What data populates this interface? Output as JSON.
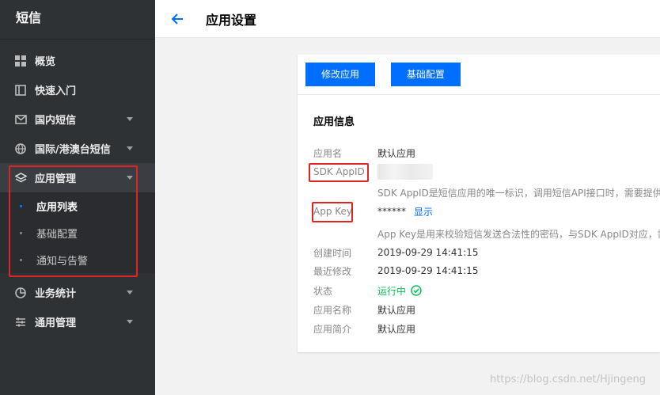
{
  "sidebar": {
    "brand": "短信",
    "items": [
      {
        "label": "概览"
      },
      {
        "label": "快速入门"
      },
      {
        "label": "国内短信"
      },
      {
        "label": "国际/港澳台短信"
      }
    ],
    "group": {
      "label": "应用管理",
      "sub": [
        {
          "label": "应用列表"
        },
        {
          "label": "基础配置"
        },
        {
          "label": "通知与告警"
        }
      ]
    },
    "bottom": [
      {
        "label": "业务统计"
      },
      {
        "label": "通用管理"
      }
    ]
  },
  "header": {
    "title": "应用设置"
  },
  "card": {
    "buttons": {
      "edit": "修改应用",
      "config": "基础配置"
    },
    "section_title": "应用信息",
    "rows": {
      "app_name": {
        "label": "应用名",
        "value": "默认应用"
      },
      "sdk_appid": {
        "label": "SDK AppID"
      },
      "sdk_hint": "SDK AppID是短信应用的唯一标识，调用短信API接口时，需要提供",
      "app_key": {
        "label": "App Key",
        "masked": "******",
        "show": "显示"
      },
      "key_hint": "App Key是用来校验短信发送合法性的密码，与SDK AppID对应，需",
      "created": {
        "label": "创建时间",
        "value": "2019-09-29 14:41:15"
      },
      "modified": {
        "label": "最近修改",
        "value": "2019-09-29 14:41:15"
      },
      "status": {
        "label": "状态",
        "value": "运行中"
      },
      "full_name": {
        "label": "应用名称",
        "value": "默认应用"
      },
      "intro": {
        "label": "应用简介",
        "value": "默认应用"
      }
    }
  },
  "watermark": "https://blog.csdn.net/Hjingeng",
  "colors": {
    "accent": "#006eff",
    "success": "#0abf5b",
    "annotation": "#e02424",
    "sidebar_bg": "#2f3235"
  }
}
